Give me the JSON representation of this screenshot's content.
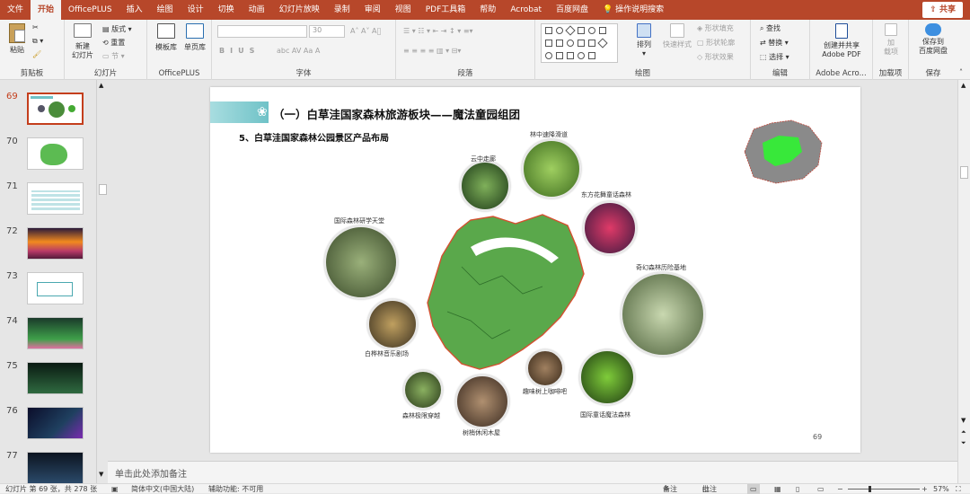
{
  "tabs": [
    "文件",
    "开始",
    "OfficePLUS",
    "插入",
    "绘图",
    "设计",
    "切换",
    "动画",
    "幻灯片放映",
    "录制",
    "审阅",
    "视图",
    "PDF工具箱",
    "帮助",
    "Acrobat",
    "百度网盘",
    "操作说明搜索"
  ],
  "share_label": "共享",
  "ribbon": {
    "clipboard": {
      "paste": "粘贴",
      "group": "剪贴板"
    },
    "slides": {
      "new": "新建\n幻灯片",
      "layout": "版式",
      "reset": "重置",
      "section": "节",
      "group": "幻灯片"
    },
    "officeplus": {
      "template": "模板库",
      "single": "单页库",
      "group": "OfficePLUS"
    },
    "font": {
      "size": "30",
      "group": "字体"
    },
    "paragraph": {
      "group": "段落"
    },
    "drawing": {
      "arrange": "排列",
      "quick_styles": "快速样式",
      "fill": "形状填充",
      "outline": "形状轮廓",
      "effects": "形状效果",
      "group": "绘图"
    },
    "editing": {
      "find": "查找",
      "replace": "替换",
      "select": "选择",
      "group": "编辑"
    },
    "adobe": {
      "create": "创建并共享\nAdobe PDF",
      "group": "Adobe Acro..."
    },
    "addins": {
      "addin": "加\n载项",
      "group": "加载项"
    },
    "save": {
      "baidu": "保存到\n百度网盘",
      "group": "保存"
    }
  },
  "thumbnails": [
    {
      "num": "69",
      "selected": true
    },
    {
      "num": "70"
    },
    {
      "num": "71"
    },
    {
      "num": "72"
    },
    {
      "num": "73"
    },
    {
      "num": "74"
    },
    {
      "num": "75"
    },
    {
      "num": "76"
    },
    {
      "num": "77"
    }
  ],
  "slide": {
    "title": "（一）白草洼国家森林旅游板块——魔法童园组团",
    "subtitle": "5、白草洼国家森林公园景区产品布局",
    "page_number": "69",
    "labels": {
      "yunzhong": "云中走廊",
      "linzhong": "林中速降滑道",
      "dongfang": "东方花舞童话森林",
      "guoji_yanxue": "国际森林研学天堂",
      "qihuan": "奇幻森林历险基地",
      "baihua": "白桦林音乐剧场",
      "quwei": "趣味树上咖啡吧",
      "guoji_tonghua": "国际童话魔法森林",
      "jixian": "森林极限穿越",
      "shushao": "树梢休闲木屋"
    }
  },
  "notes_placeholder": "单击此处添加备注",
  "status": {
    "slide_info": "幻灯片 第 69 张，共 278 张",
    "language": "简体中文(中国大陆)",
    "accessibility": "辅助功能: 不可用",
    "notes": "备注",
    "comments": "批注",
    "zoom": "57%"
  },
  "colors": {
    "accent": "#b7472a",
    "teal": "#6fc2c7",
    "map_green": "#3fa63c"
  }
}
